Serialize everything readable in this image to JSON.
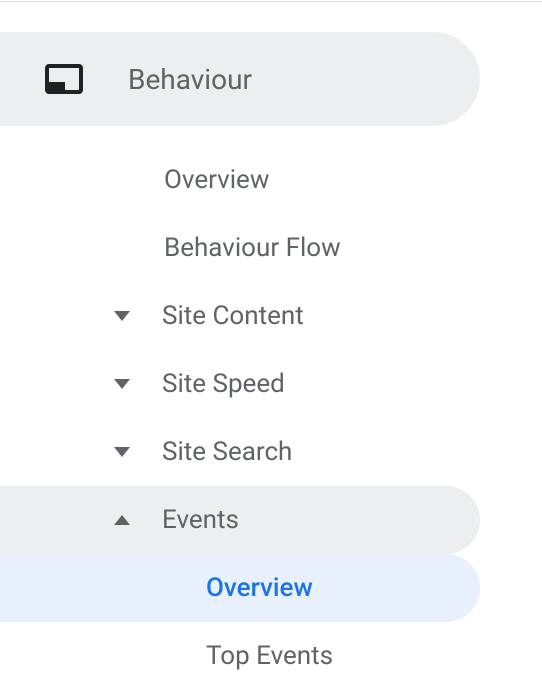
{
  "nav": {
    "section": {
      "label": "Behaviour"
    },
    "items": [
      {
        "label": "Overview",
        "has_chevron": false
      },
      {
        "label": "Behaviour Flow",
        "has_chevron": false
      },
      {
        "label": "Site Content",
        "has_chevron": true
      },
      {
        "label": "Site Speed",
        "has_chevron": true
      },
      {
        "label": "Site Search",
        "has_chevron": true
      },
      {
        "label": "Events",
        "has_chevron": true,
        "expanded": true
      }
    ],
    "events_children": [
      {
        "label": "Overview",
        "selected": true
      },
      {
        "label": "Top Events",
        "selected": false
      }
    ]
  }
}
